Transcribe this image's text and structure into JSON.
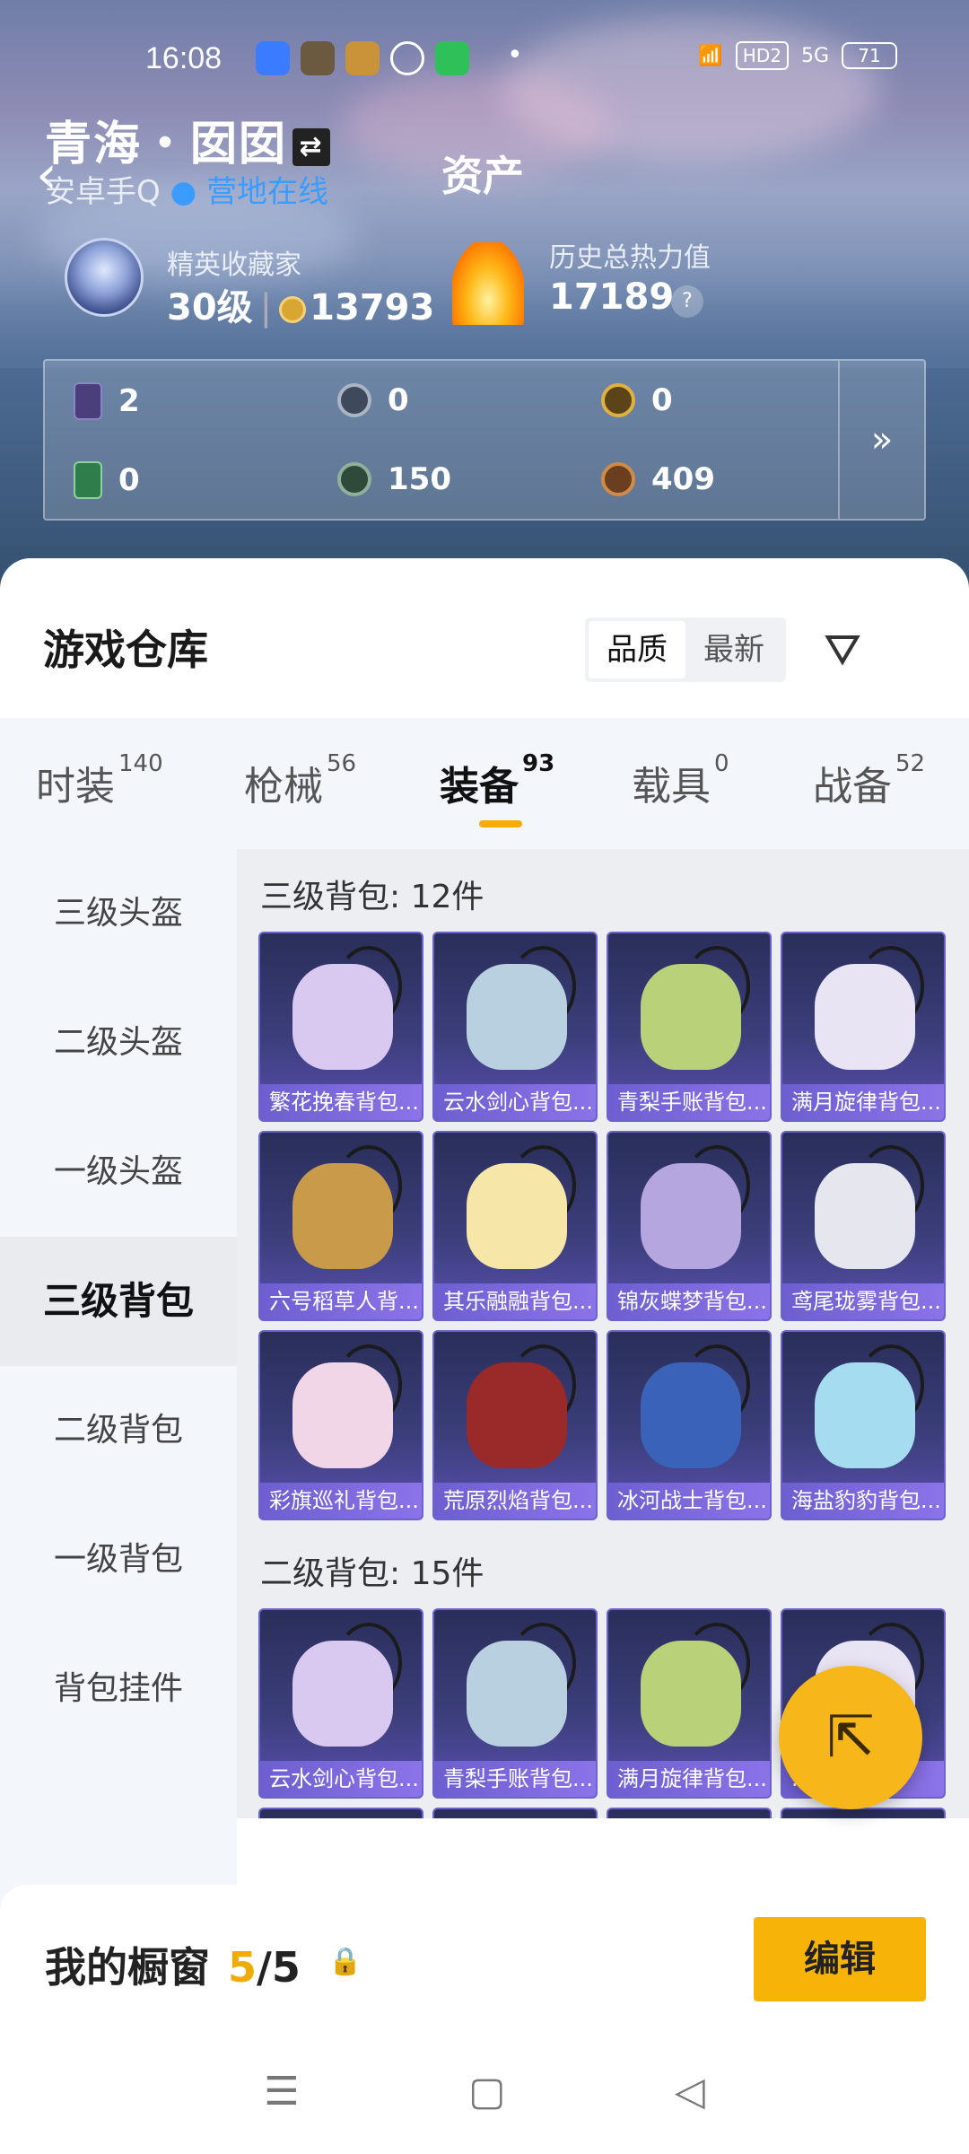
{
  "status_bar": {
    "time": "16:08",
    "network_badge": "HD2",
    "network": "5G",
    "battery": "71"
  },
  "header": {
    "back_icon": "chevron-left-icon",
    "username": "青海・囡囡",
    "swap_icon": "swap-icon",
    "platform": "安卓手Q",
    "online_status": "营地在线",
    "page_title": "资产"
  },
  "profile": {
    "rank_label": "精英收藏家",
    "level": "30级",
    "coins": "13793",
    "heat_label": "历史总热力值",
    "heat_value": "17189",
    "help_icon": "?"
  },
  "assets": [
    {
      "icon": "purple-card-icon",
      "value": "2"
    },
    {
      "icon": "silver-coin-icon",
      "value": "0"
    },
    {
      "icon": "gold-coin-icon",
      "value": "0"
    },
    {
      "icon": "green-card-icon",
      "value": "0"
    },
    {
      "icon": "green-coin-icon",
      "value": "150"
    },
    {
      "icon": "bronze-coin-icon",
      "value": "409"
    }
  ],
  "assets_more": "»",
  "warehouse": {
    "title": "游戏仓库",
    "sort": [
      "品质",
      "最新"
    ],
    "filter_icon": "filter-icon"
  },
  "tabs": [
    {
      "label": "时装",
      "count": "140"
    },
    {
      "label": "枪械",
      "count": "56"
    },
    {
      "label": "装备",
      "count": "93"
    },
    {
      "label": "载具",
      "count": "0"
    },
    {
      "label": "战备",
      "count": "52"
    }
  ],
  "sidebar": [
    "三级头盔",
    "二级头盔",
    "一级头盔",
    "三级背包",
    "二级背包",
    "一级背包",
    "背包挂件"
  ],
  "sections": [
    {
      "title": "三级背包: 12件",
      "items": [
        "繁花挽春背包...",
        "云水剑心背包...",
        "青梨手账背包...",
        "满月旋律背包...",
        "六号稻草人背...",
        "其乐融融背包...",
        "锦灰蝶梦背包...",
        "鸢尾珑雾背包...",
        "彩旗巡礼背包...",
        "荒原烈焰背包...",
        "冰河战士背包...",
        "海盐豹豹背包..."
      ]
    },
    {
      "title": "二级背包: 15件",
      "items": [
        "云水剑心背包...",
        "青梨手账背包...",
        "满月旋律背包...",
        "...",
        "",
        "",
        "",
        ""
      ]
    }
  ],
  "showcase": {
    "title": "我的橱窗",
    "count": "5",
    "total": "/5",
    "lock_icon": "lock-icon",
    "edit_label": "编辑"
  },
  "fab_icon": "share-icon",
  "nav": {
    "menu": "☰",
    "home": "▢",
    "back": "◁"
  },
  "colors": {
    "accent": "#f7b308",
    "online": "#3b9cff",
    "tile": "#3b3e7a"
  }
}
